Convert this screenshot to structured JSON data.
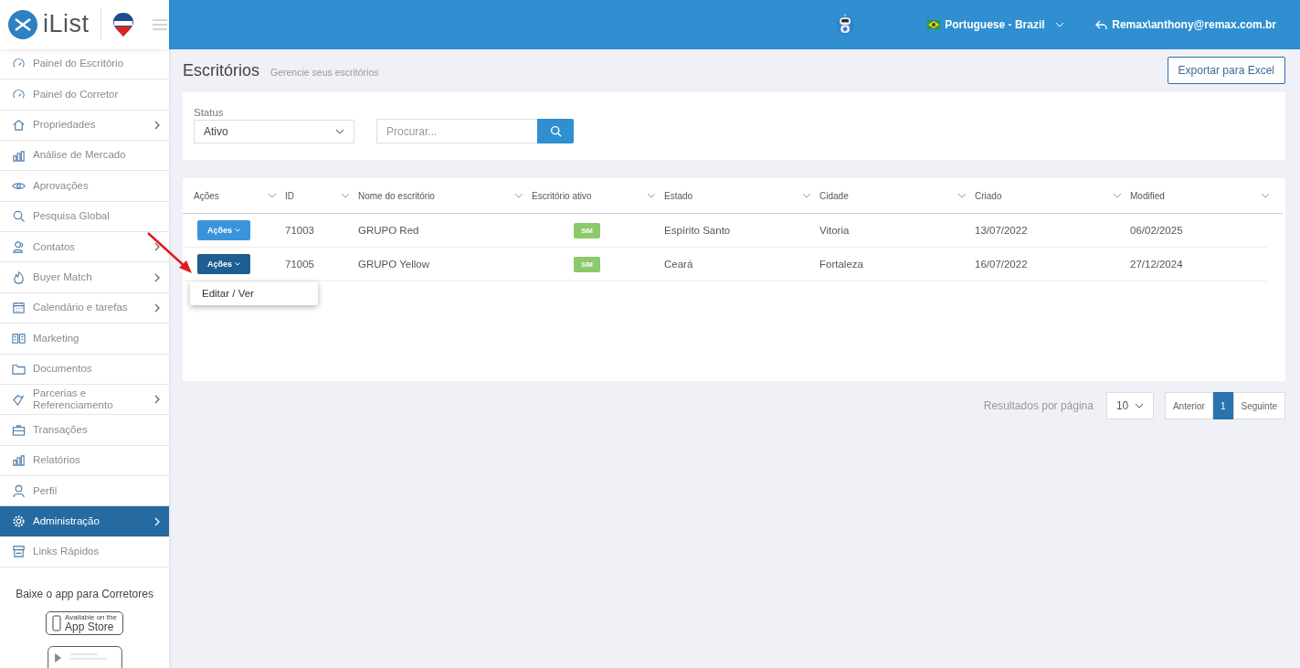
{
  "sidebar": {
    "brand": "iList",
    "items": [
      {
        "label": "Painel do Escritório",
        "has_submenu": false,
        "selected": false
      },
      {
        "label": "Painel do Corretor",
        "has_submenu": false,
        "selected": false
      },
      {
        "label": "Propriedades",
        "has_submenu": true,
        "selected": false
      },
      {
        "label": "Análise de Mercado",
        "has_submenu": false,
        "selected": false
      },
      {
        "label": "Aprovações",
        "has_submenu": false,
        "selected": false
      },
      {
        "label": "Pesquisa Global",
        "has_submenu": false,
        "selected": false
      },
      {
        "label": "Contatos",
        "has_submenu": true,
        "selected": false
      },
      {
        "label": "Buyer Match",
        "has_submenu": true,
        "selected": false
      },
      {
        "label": "Calendário e tarefas",
        "has_submenu": true,
        "selected": false
      },
      {
        "label": "Marketing",
        "has_submenu": false,
        "selected": false
      },
      {
        "label": "Documentos",
        "has_submenu": false,
        "selected": false
      },
      {
        "label": "Parcerias e Referenciamento",
        "has_submenu": true,
        "selected": false
      },
      {
        "label": "Transações",
        "has_submenu": false,
        "selected": false
      },
      {
        "label": "Relatórios",
        "has_submenu": false,
        "selected": false
      },
      {
        "label": "Perfil",
        "has_submenu": false,
        "selected": false
      },
      {
        "label": "Administração",
        "has_submenu": true,
        "selected": true
      },
      {
        "label": "Links Rápidos",
        "has_submenu": false,
        "selected": false
      }
    ],
    "app_promo": "Baixe o app para Corretores",
    "app_store_badge": {
      "small": "Available on the",
      "large": "App Store"
    }
  },
  "header": {
    "language": "Portuguese - Brazil",
    "user": "Remax\\anthony@remax.com.br"
  },
  "page": {
    "title": "Escritórios",
    "subtitle": "Gerencie seus escritórios",
    "export_button": "Exportar para Excel"
  },
  "filters": {
    "status_label": "Status",
    "status_value": "Ativo",
    "search_placeholder": "Procurar..."
  },
  "table": {
    "columns": [
      "Ações",
      "ID",
      "Nome do escritório",
      "Escritório ativo",
      "Estado",
      "Cidade",
      "Criado",
      "Modified"
    ],
    "rows": [
      {
        "action": "Ações",
        "expanded": false,
        "id": "71003",
        "name": "GRUPO Red",
        "active": "SIM",
        "state": "Espírito Santo",
        "city": "Vitoria",
        "created": "13/07/2022",
        "modified": "06/02/2025"
      },
      {
        "action": "Ações",
        "expanded": true,
        "id": "71005",
        "name": "GRUPO Yellow",
        "active": "SIM",
        "state": "Ceará",
        "city": "Fortaleza",
        "created": "16/07/2022",
        "modified": "27/12/2024"
      }
    ],
    "action_menu": [
      "Editar / Ver"
    ]
  },
  "pagination": {
    "per_page_label": "Resultados por página",
    "per_page": "10",
    "previous": "Anterior",
    "pages": [
      {
        "label": "1",
        "selected": true
      }
    ],
    "next": "Seguinte"
  }
}
